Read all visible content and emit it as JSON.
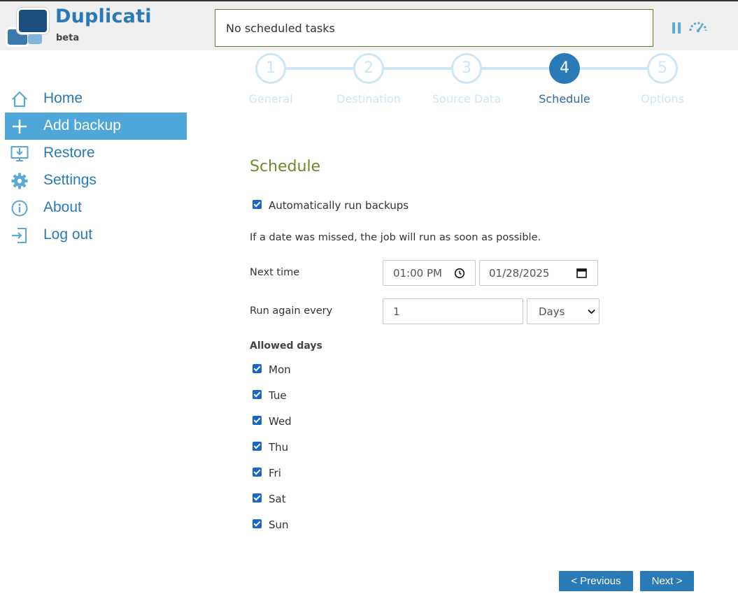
{
  "header": {
    "brand": "Duplicati",
    "badge": "beta",
    "status": "No scheduled tasks",
    "icons": [
      "pause-icon",
      "throttle-speed-icon"
    ]
  },
  "sidebar": {
    "items": [
      {
        "label": "Home",
        "icon": "home-icon",
        "active": false
      },
      {
        "label": "Add backup",
        "icon": "plus-icon",
        "active": true
      },
      {
        "label": "Restore",
        "icon": "restore-icon",
        "active": false
      },
      {
        "label": "Settings",
        "icon": "gear-icon",
        "active": false
      },
      {
        "label": "About",
        "icon": "info-icon",
        "active": false
      },
      {
        "label": "Log out",
        "icon": "logout-icon",
        "active": false
      }
    ]
  },
  "stepper": {
    "steps": [
      {
        "number": "1",
        "label": "General"
      },
      {
        "number": "2",
        "label": "Destination"
      },
      {
        "number": "3",
        "label": "Source Data"
      },
      {
        "number": "4",
        "label": "Schedule"
      },
      {
        "number": "5",
        "label": "Options"
      }
    ],
    "current": 4
  },
  "schedule": {
    "title": "Schedule",
    "auto_run_label": "Automatically run backups",
    "auto_run_checked": true,
    "missed_note": "If a date was missed, the job will run as soon as possible.",
    "next_time_label": "Next time",
    "next_time_value": "01:00 PM",
    "next_date_value": "01/28/2025",
    "run_again_label": "Run again every",
    "run_again_value": "1",
    "run_again_unit": "Days",
    "allowed_days_label": "Allowed days",
    "days": [
      {
        "label": "Mon",
        "checked": true
      },
      {
        "label": "Tue",
        "checked": true
      },
      {
        "label": "Wed",
        "checked": true
      },
      {
        "label": "Thu",
        "checked": true
      },
      {
        "label": "Fri",
        "checked": true
      },
      {
        "label": "Sat",
        "checked": true
      },
      {
        "label": "Sun",
        "checked": true
      }
    ]
  },
  "footer": {
    "previous_label": "< Previous",
    "next_label": "Next >"
  },
  "colors": {
    "accent": "#2a7ab8",
    "sidebar_active": "#4fa7d9",
    "title_green": "#6d8a2e",
    "step_inactive": "#cfe6f4"
  }
}
